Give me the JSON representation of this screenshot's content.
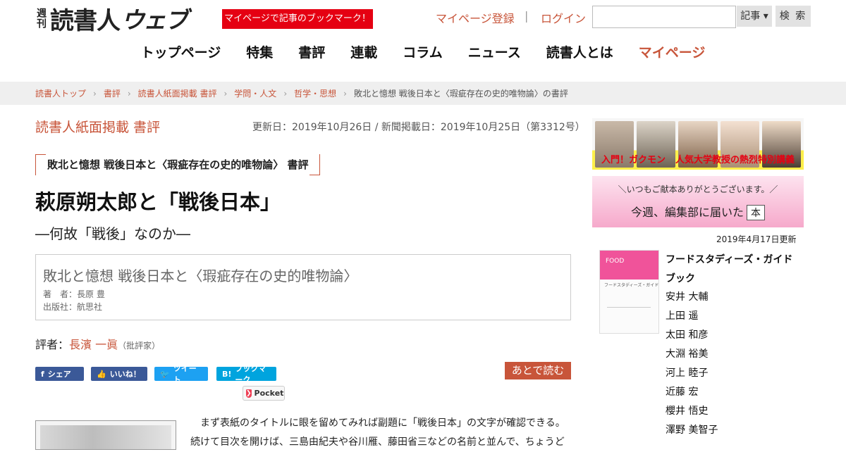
{
  "header": {
    "logo_weekly": "週刊",
    "logo_main": "読書人",
    "logo_web": "ウェブ",
    "bookmark_badge": "マイページで記事のブックマーク！",
    "mypage_register": "マイページ登録",
    "separator": "|",
    "login": "ログイン",
    "search_value": "",
    "search_category": "記事 ▾",
    "search_button": "検 索"
  },
  "nav": [
    {
      "label": "トップページ",
      "active": false
    },
    {
      "label": "特集",
      "active": false
    },
    {
      "label": "書評",
      "active": false
    },
    {
      "label": "連載",
      "active": false
    },
    {
      "label": "コラム",
      "active": false
    },
    {
      "label": "ニュース",
      "active": false
    },
    {
      "label": "読書人とは",
      "active": false
    },
    {
      "label": "マイページ",
      "active": true
    }
  ],
  "breadcrumb": [
    "読書人トップ",
    "書評",
    "読書人紙面掲載 書評",
    "学問・人文",
    "哲学・思想",
    "敗北と憶想 戦後日本と〈瑕疵存在の史的唯物論〉の書評"
  ],
  "article": {
    "section_label": "読書人紙面掲載 書評",
    "dates": "更新日：2019年10月26日 / 新聞掲載日：2019年10月25日（第3312号）",
    "kicker": "敗北と憶想 戦後日本と〈瑕疵存在の史的唯物論〉 書評",
    "headline": "萩原朔太郎と「戦後日本」",
    "subhead": "―何故「戦後」なのか―",
    "book_title": "敗北と憶想 戦後日本と〈瑕疵存在の史的唯物論〉",
    "book_author": "著　者：長原 豊",
    "book_publisher": "出版社：航思社",
    "reviewer_prefix": "評者：",
    "reviewer_name": "長濱 一眞",
    "reviewer_role": "（批評家）",
    "body": [
      "　まず表紙のタイトルに眼を留めてみれば副題に「戦後日本」の文字が確認できる。",
      "続けて目次を開けば、三島由紀夫や谷川雁、藤田省三などの名前と並んで、ちょうど"
    ]
  },
  "share": {
    "facebook": "シェア",
    "facebook_icon": "f",
    "like": "いいね！",
    "like_icon": "👍",
    "twitter": "ツイート",
    "twitter_icon": "🐦",
    "hatena": "ブックマーク",
    "hatena_icon": "B!",
    "pocket": "Pocket",
    "read_later": "あとで読む"
  },
  "sidebar": {
    "banner1_left": "入門！ガクモン",
    "banner1_right": "人気大学教授の熱烈特別講義",
    "banner2_small": "＼いつもご献本ありがとうございます。／",
    "banner2_big": "今週、編集部に届いた",
    "banner2_hon": "本",
    "updated": "2019年4月17日更新",
    "book_title": "フードスタディーズ・ガイドブック",
    "authors": [
      "安井 大輔",
      "上田 遥",
      "太田 和彦",
      "大淵 裕美",
      "河上 睦子",
      "近藤 宏",
      "櫻井 悟史",
      "澤野 美智子"
    ]
  },
  "colors": {
    "accent": "#c8553a",
    "badge_red": "#e50012",
    "facebook": "#3b5998",
    "twitter": "#1da1f2",
    "hatena": "#00a4de",
    "pocket": "#ee4056"
  }
}
